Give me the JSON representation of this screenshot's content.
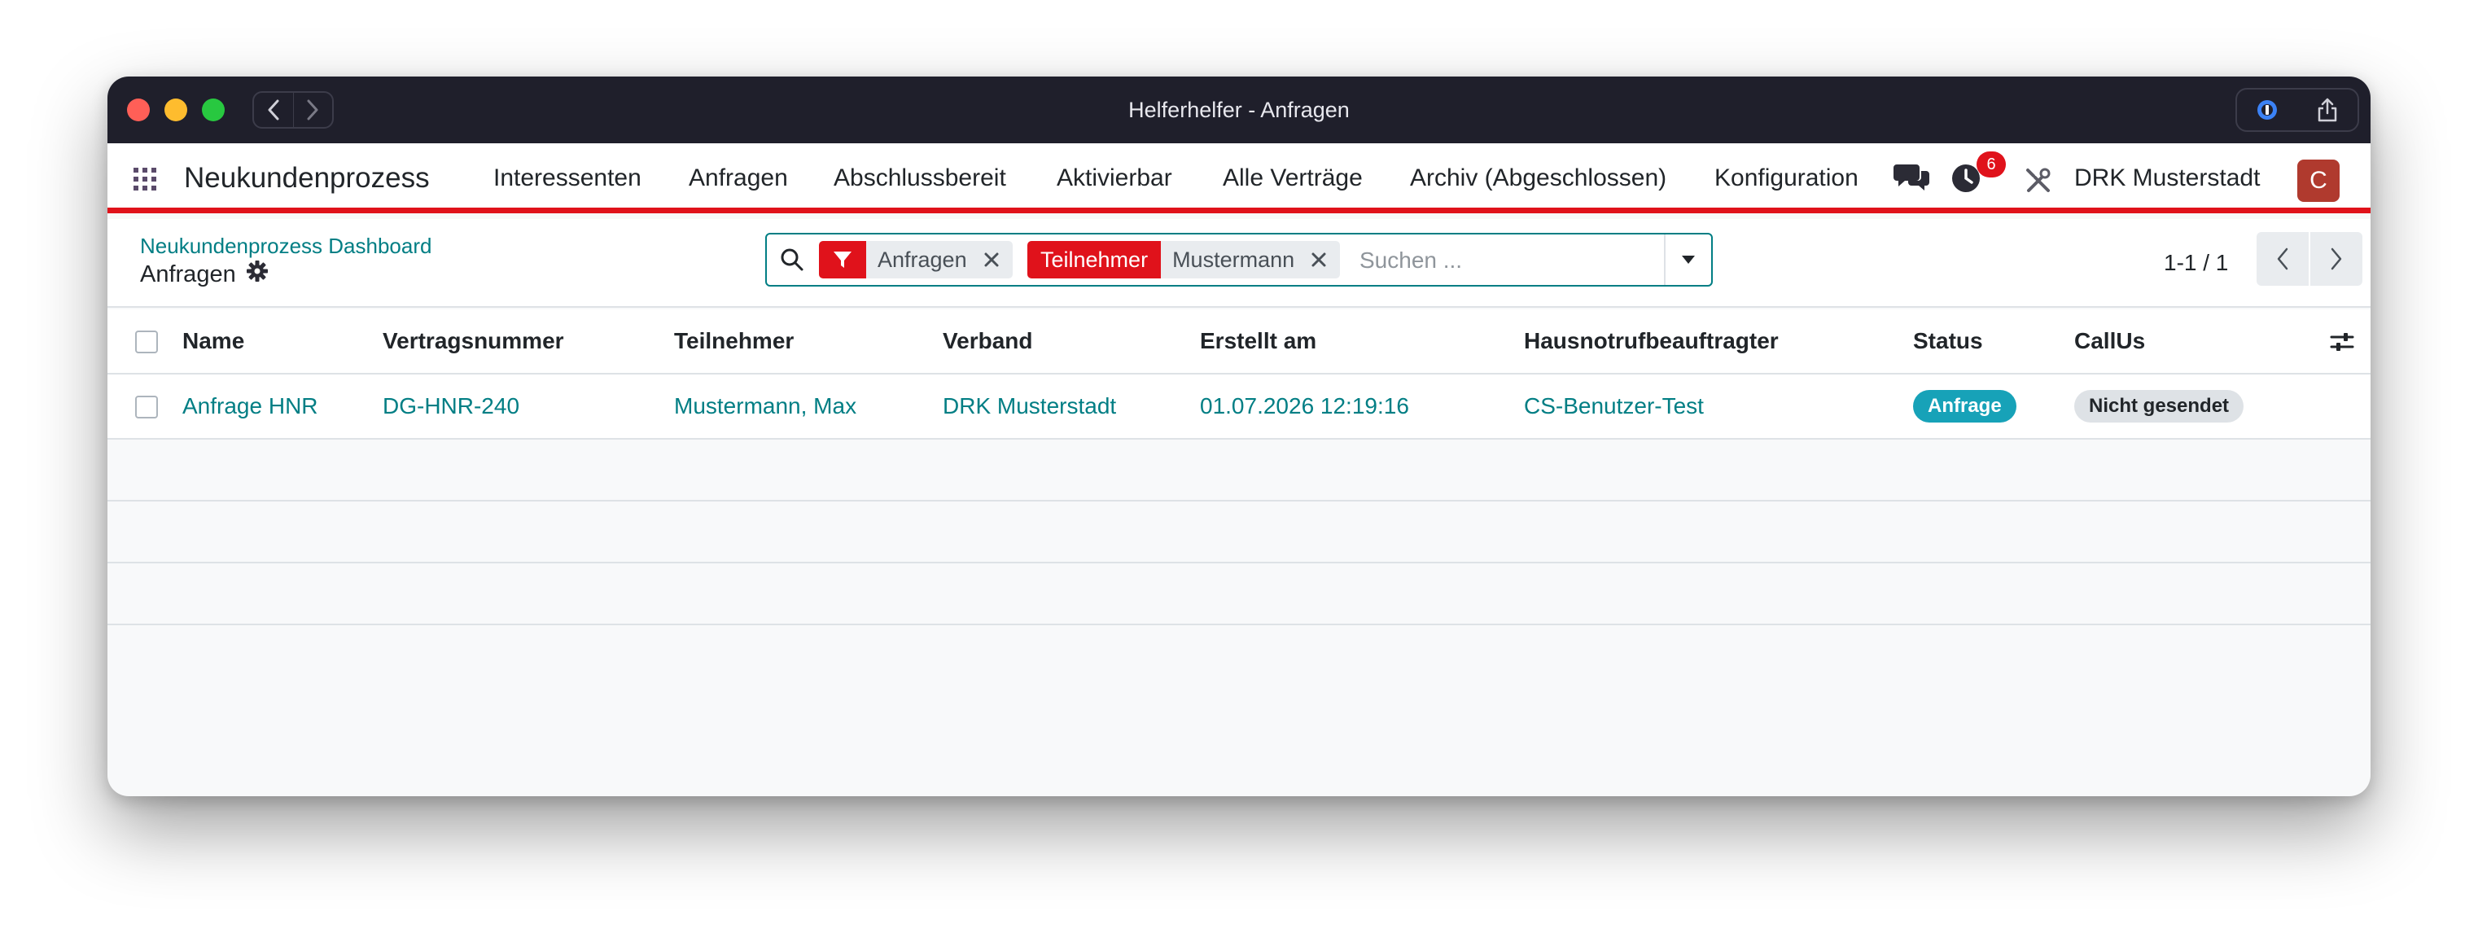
{
  "window": {
    "title": "Helferhelfer - Anfragen"
  },
  "navbar": {
    "brand": "Neukundenprozess",
    "menu": [
      "Interessenten",
      "Anfragen",
      "Abschlussbereit",
      "Aktivierbar",
      "Alle Verträge",
      "Archiv (Abgeschlossen)",
      "Konfiguration"
    ],
    "activity_count": "6",
    "company": "DRK Musterstadt",
    "avatar_letter": "C"
  },
  "breadcrumb": {
    "parent": "Neukundenprozess Dashboard",
    "current": "Anfragen"
  },
  "search": {
    "facets": [
      {
        "type": "filter",
        "icon": "filter-icon",
        "value": "Anfragen"
      },
      {
        "type": "field",
        "label": "Teilnehmer",
        "value": "Mustermann"
      }
    ],
    "placeholder": "Suchen ..."
  },
  "pager": {
    "value": "1-1 / 1"
  },
  "table": {
    "columns": [
      "Name",
      "Vertragsnummer",
      "Teilnehmer",
      "Verband",
      "Erstellt am",
      "Hausnotrufbeauftragter",
      "Status",
      "CallUs"
    ],
    "rows": [
      {
        "name": "Anfrage HNR",
        "vertragsnummer": "DG-HNR-240",
        "teilnehmer": "Mustermann, Max",
        "verband": "DRK Musterstadt",
        "erstellt_am": "01.07.2026 12:19:16",
        "hausnotrufbeauftragter": "CS-Benutzer-Test",
        "status": "Anfrage",
        "callus": "Nicht gesendet"
      }
    ]
  },
  "colors": {
    "accent_red": "#e0121b",
    "link_teal": "#017e84",
    "status_badge": "#17a2b8"
  }
}
